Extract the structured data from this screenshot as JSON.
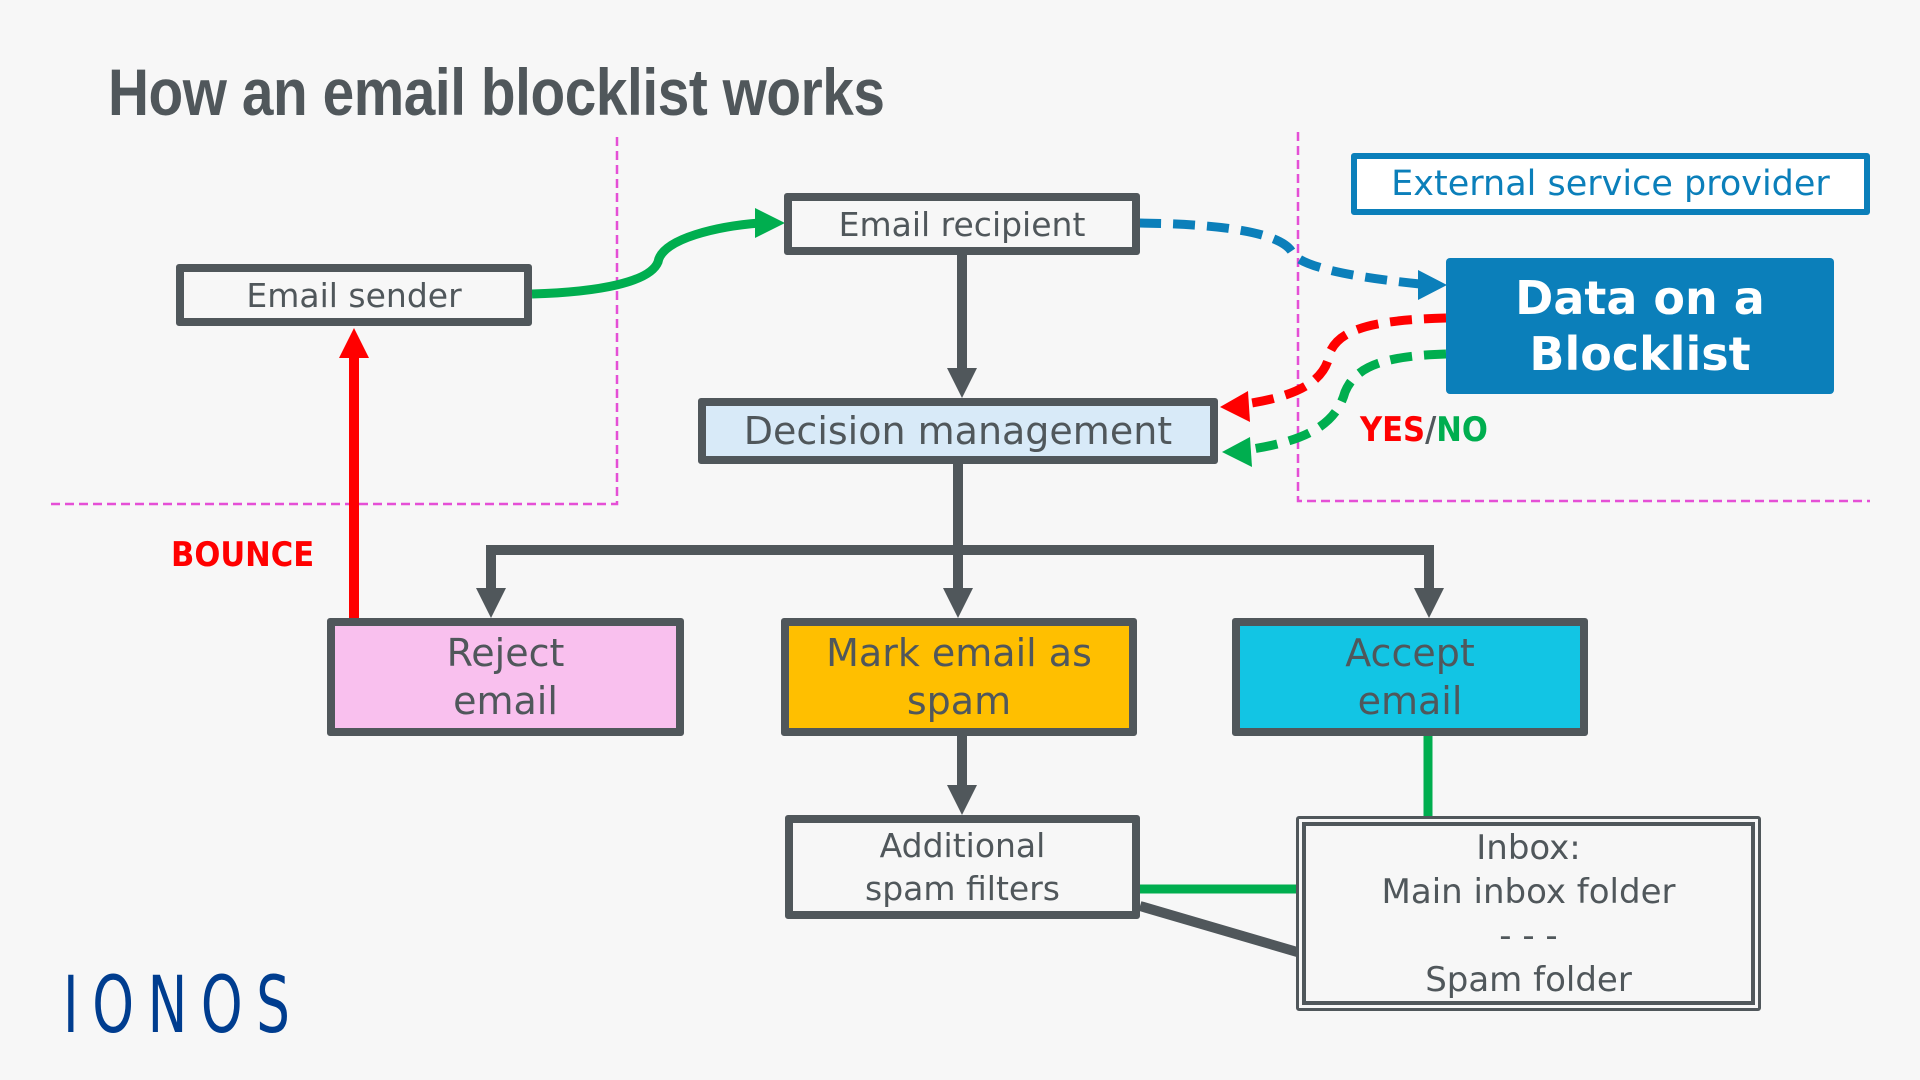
{
  "title": "How an email blocklist works",
  "colors": {
    "text_gray": "#50575b",
    "boundary_magenta": "#e54fd6",
    "flow_green": "#00ae4f",
    "bounce_red": "#ff0000",
    "provider_blue": "#0b7fba",
    "reject_pink": "#f9c0ee",
    "spam_yellow": "#ffbf00",
    "accept_cyan": "#12c5e4",
    "decision_lightblue": "#d8eaf8",
    "logo_blue": "#003d8f"
  },
  "nodes": {
    "sender": {
      "label": "Email sender"
    },
    "recipient": {
      "label": "Email recipient"
    },
    "decision": {
      "label": "Decision management"
    },
    "reject": {
      "line1": "Reject",
      "line2": "email"
    },
    "spam": {
      "line1": "Mark email as",
      "line2": "spam"
    },
    "accept": {
      "line1": "Accept",
      "line2": "email"
    },
    "filters": {
      "line1": "Additional",
      "line2": "spam filters"
    },
    "inbox": {
      "line1": "Inbox:",
      "line2": "Main inbox folder",
      "separator": "- - -",
      "line3": "Spam folder"
    },
    "external": {
      "label": "External service provider"
    },
    "blocklist": {
      "line1": "Data on a",
      "line2": "Blocklist"
    }
  },
  "labels": {
    "bounce": "BOUNCE",
    "yes": "YES",
    "slash": "/",
    "no": "NO"
  },
  "edges": [
    {
      "from": "sender",
      "to": "recipient",
      "style": "solid",
      "color": "green"
    },
    {
      "from": "recipient",
      "to": "blocklist",
      "style": "dashed",
      "color": "blue"
    },
    {
      "from": "blocklist",
      "to": "decision",
      "style": "dashed",
      "color": "red",
      "label": "YES"
    },
    {
      "from": "blocklist",
      "to": "decision",
      "style": "dashed",
      "color": "green",
      "label": "NO"
    },
    {
      "from": "recipient",
      "to": "decision",
      "style": "solid",
      "color": "gray"
    },
    {
      "from": "decision",
      "to": "reject",
      "style": "solid",
      "color": "gray"
    },
    {
      "from": "decision",
      "to": "spam",
      "style": "solid",
      "color": "gray"
    },
    {
      "from": "decision",
      "to": "accept",
      "style": "solid",
      "color": "gray"
    },
    {
      "from": "reject",
      "to": "sender",
      "style": "solid",
      "color": "red",
      "label": "BOUNCE"
    },
    {
      "from": "spam",
      "to": "filters",
      "style": "solid",
      "color": "gray"
    },
    {
      "from": "accept",
      "to": "inbox.main",
      "style": "solid",
      "color": "green"
    },
    {
      "from": "filters",
      "to": "inbox.main",
      "style": "solid",
      "color": "green"
    },
    {
      "from": "filters",
      "to": "inbox.spam",
      "style": "solid",
      "color": "gray"
    }
  ],
  "logo": {
    "text": "IONOS"
  }
}
